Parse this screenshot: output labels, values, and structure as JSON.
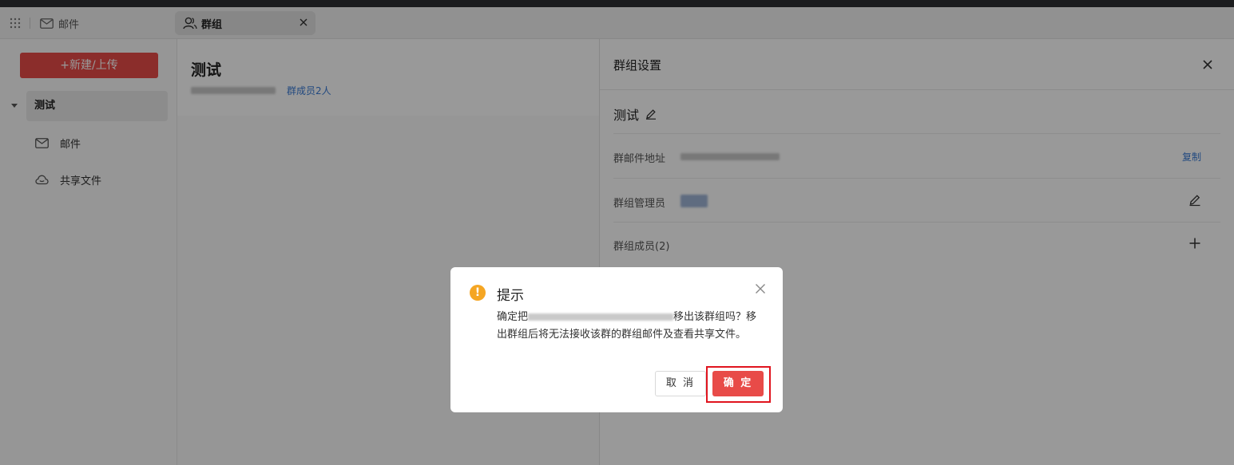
{
  "tabs": {
    "mail_label": "邮件",
    "group_label": "群组"
  },
  "sidebar": {
    "new_button": "+新建/上传",
    "group_name": "测试",
    "items": [
      {
        "label": "邮件",
        "icon": "mail-icon"
      },
      {
        "label": "共享文件",
        "icon": "cloud-icon"
      }
    ]
  },
  "middle": {
    "title": "测试",
    "members_link": "群成员2人"
  },
  "panel": {
    "title": "群组设置",
    "group_name": "测试",
    "mail_address_label": "群邮件地址",
    "copy_label": "复制",
    "admin_label": "群组管理员",
    "members_label": "群组成员(2)"
  },
  "dialog": {
    "title": "提示",
    "body_prefix": "确定把",
    "body_suffix": "移出该群组吗？移出群组后将无法接收该群的群组邮件及查看共享文件。",
    "cancel_label": "取 消",
    "ok_label": "确 定"
  },
  "colors": {
    "accent": "#e84b48",
    "link": "#3a7bd5",
    "warning": "#f5a623",
    "highlight_frame": "#e0141e"
  }
}
